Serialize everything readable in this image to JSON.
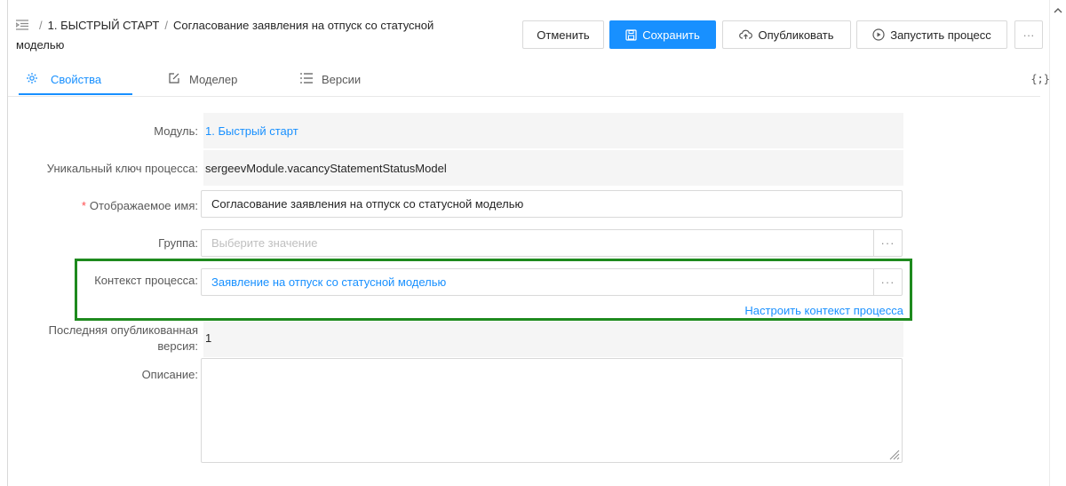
{
  "breadcrumb": {
    "section": "1. БЫСТРЫЙ СТАРТ",
    "title_line1": "Согласование заявления на отпуск со статусной",
    "title_line2": "моделью"
  },
  "toolbar": {
    "cancel_label": "Отменить",
    "save_label": "Сохранить",
    "publish_label": "Опубликовать",
    "run_label": "Запустить процесс",
    "more_label": "···"
  },
  "tabs": [
    {
      "label": "Свойства",
      "icon": "gear-icon",
      "active": true
    },
    {
      "label": "Моделер",
      "icon": "edit-icon",
      "active": false
    },
    {
      "label": "Версии",
      "icon": "list-icon",
      "active": false
    }
  ],
  "json_toggle": "{;}",
  "form": {
    "module": {
      "label": "Модуль:",
      "value": "1. Быстрый старт"
    },
    "process_key": {
      "label": "Уникальный ключ процесса:",
      "value": "sergeevModule.vacancyStatementStatusModel"
    },
    "display_name": {
      "required_mark": "*",
      "label": "Отображаемое имя:",
      "value": "Согласование заявления на отпуск  со статусной моделью"
    },
    "group": {
      "label": "Группа:",
      "placeholder": "Выберите значение"
    },
    "context": {
      "label": "Контекст процесса:",
      "value": "Заявление на отпуск со статусной моделью",
      "configure_link": "Настроить контекст процесса"
    },
    "last_version": {
      "label_line1": "Последняя опубликованная",
      "label_line2": "версия:",
      "value": "1"
    },
    "description": {
      "label": "Описание:"
    }
  },
  "colors": {
    "accent": "#1890ff",
    "highlight": "#1e8a1e",
    "required": "#ff4d4f"
  }
}
